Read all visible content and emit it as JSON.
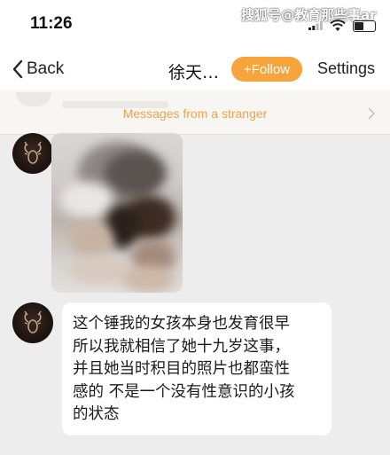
{
  "status_bar": {
    "time": "11:26",
    "watermark": "搜狐号@教育那些事ar",
    "icons": [
      "signal-icon",
      "wifi-icon",
      "battery-icon"
    ]
  },
  "nav": {
    "back_label": "Back",
    "title": "徐天…",
    "follow_label": "+Follow",
    "settings_label": "Settings"
  },
  "stranger_banner": {
    "text": "Messages from a stranger"
  },
  "messages": [
    {
      "type": "image",
      "description_hidden": true
    },
    {
      "type": "text",
      "lines": [
        "这个锤我的女孩本身也发育很早",
        "所以我就相信了她十九岁这事，",
        "并且她当时积目的照片也都蛮性",
        "感的 不是一个没有性意识的小孩",
        "的状态"
      ]
    }
  ],
  "colors": {
    "accent": "#f7a53a",
    "banner_text": "#f0a14c",
    "chat_background": "#ededed",
    "bubble": "#ffffff"
  }
}
